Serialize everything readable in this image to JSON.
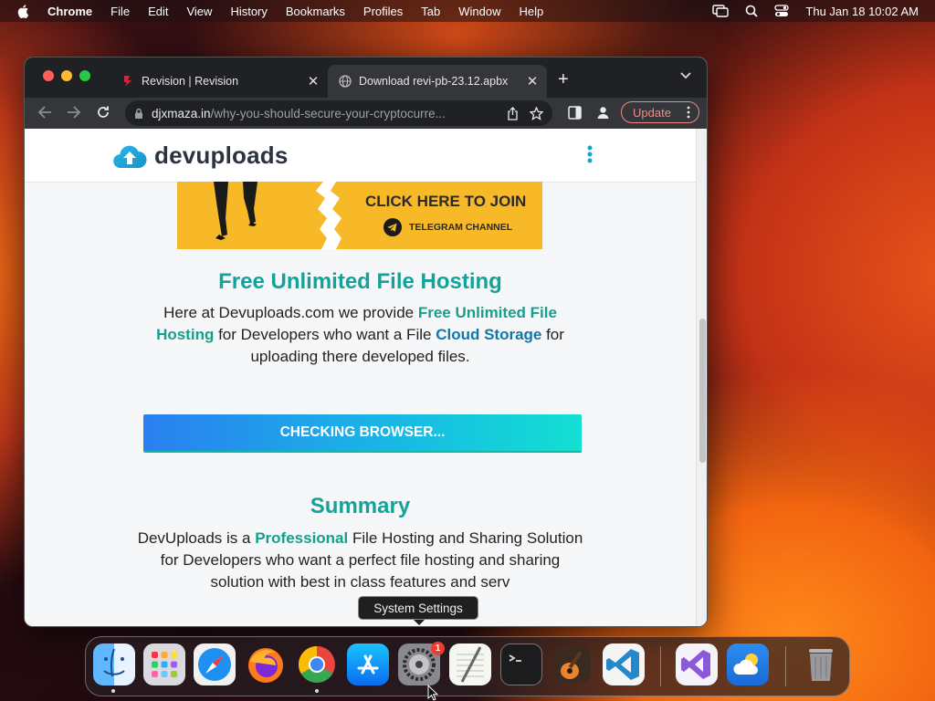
{
  "menubar": {
    "app": "Chrome",
    "items": [
      "File",
      "Edit",
      "View",
      "History",
      "Bookmarks",
      "Profiles",
      "Tab",
      "Window",
      "Help"
    ],
    "clock": "Thu Jan 18  10:02 AM"
  },
  "browser": {
    "tabs": [
      {
        "title": "Revision | Revision",
        "icon": "revision-favicon",
        "active": false
      },
      {
        "title": "Download revi-pb-23.12.apbx",
        "icon": "globe-favicon",
        "active": true
      }
    ],
    "url_host": "djxmaza.in",
    "url_path": "/why-you-should-secure-your-cryptocurre...",
    "update_label": "Update"
  },
  "page": {
    "logo_text": "devuploads",
    "banner_title": "CLICK HERE TO JOIN",
    "banner_sub": "TELEGRAM CHANNEL",
    "hosting_heading": "Free Unlimited File Hosting",
    "hosting_para": {
      "t1": "Here at Devuploads.com we provide ",
      "b1": "Free Unlimited File Hosting",
      "t2": " for Developers who want a File ",
      "b2": "Cloud Storage",
      "t3": " for uploading there developed files."
    },
    "check_button": "CHECKING BROWSER...",
    "summary_heading": "Summary",
    "summary_para": {
      "t1": "DevUploads is a ",
      "b1": "Professional",
      "t2": " File Hosting and Sharing Solution for Developers who want a perfect file hosting and sharing solution with best in class features and serv"
    }
  },
  "tooltip": "System Settings",
  "dock": {
    "items": [
      "Finder",
      "Launchpad",
      "Safari",
      "Firefox",
      "Google Chrome",
      "App Store",
      "System Settings",
      "TextEdit",
      "Terminal",
      "GarageBand",
      "Visual Studio Code",
      "Visual Studio",
      "Weather",
      "Trash"
    ],
    "system_settings_badge": "1"
  },
  "colors": {
    "accent_teal": "#14a39a",
    "link_blue": "#0f78a9",
    "update_red": "#f28b82"
  }
}
